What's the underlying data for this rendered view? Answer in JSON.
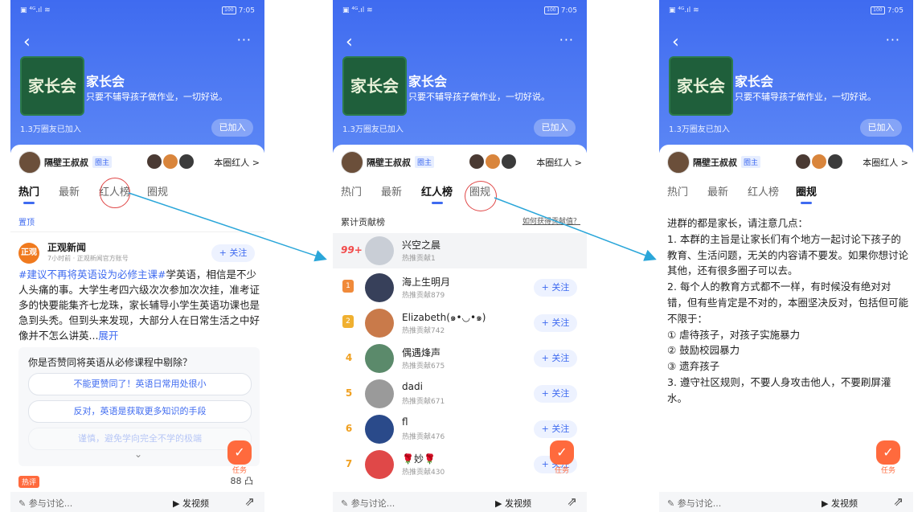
{
  "status": {
    "time": "7:05",
    "battery": "100"
  },
  "group": {
    "cover_text": "家长会",
    "title": "家长会",
    "desc": "只要不辅导孩子做作业，一切好说。",
    "members": "1.3万圈友已加入",
    "joined_label": "已加入",
    "owner": "隔壁王叔叔",
    "owner_badge": "圈主",
    "red_talent": "本圈红人 >"
  },
  "tabs": [
    "热门",
    "最新",
    "红人榜",
    "圈规"
  ],
  "screen1": {
    "pin": "置顶",
    "news_icon": "正观",
    "news_name": "正观新闻",
    "news_meta": "7小时前 · 正观新闻官方账号",
    "follow": "+ 关注",
    "post_tag": "#建议不再将英语设为必修主课#",
    "post_body": "学英语，相信是不少人头痛的事。大学生考四六级次次参加次次挂，准考证多的快要能集齐七龙珠，家长辅导小学生英语功课也是急到头秃。但到头来发现，大部分人在日常生活之中好像并不怎么讲英...",
    "expand": "展开",
    "poll_question": "你是否赞同将英语从必修课程中剔除？",
    "poll_options": [
      "不能更赞同了！英语日常用处很小",
      "反对，英语是获取更多知识的手段",
      "谨慎，避免学向完全不学的极端"
    ],
    "hot": "热评",
    "likes": "88 凸"
  },
  "screen2": {
    "rank_title": "累计贡献榜",
    "rank_link": "如何获得贡献值？",
    "me": {
      "rank": "99+",
      "name": "兴空之晨",
      "sub": "热推贡献1"
    },
    "rows": [
      {
        "rank": "1",
        "name": "海上生明月",
        "sub": "热推贡献879",
        "color": "#f08a3a"
      },
      {
        "rank": "2",
        "name": "Elizabeth(๑•◡•๑)",
        "sub": "热推贡献742",
        "color": "#f0b030"
      },
      {
        "rank": "4",
        "name": "偶遇烽声",
        "sub": "热推贡献675",
        "color": "#5b8a6b"
      },
      {
        "rank": "5",
        "name": "dadi",
        "sub": "热推贡献671",
        "color": "#9a9a9a"
      },
      {
        "rank": "6",
        "name": "fl",
        "sub": "热推贡献476",
        "color": "#2a4a8a"
      },
      {
        "rank": "7",
        "name": "🌹妙🌹",
        "sub": "热推贡献430",
        "color": "#e04848"
      }
    ],
    "follow": "+ 关注"
  },
  "screen3": {
    "rules": [
      "进群的都是家长，请注意几点：",
      "1. 本群的主旨是让家长们有个地方一起讨论下孩子的教育、生活问题，无关的内容请不要发。如果你想讨论其他，还有很多圈子可以去。",
      "2. 每个人的教育方式都不一样，有时候没有绝对对错，但有些肯定是不对的，本圈坚决反对，包括但可能不限于：",
      "① 虐待孩子，对孩子实施暴力",
      "② 鼓励校园暴力",
      "③ 遗弃孩子",
      "3. 遵守社区规则，不要人身攻击他人，不要刷屏灌水。"
    ]
  },
  "fab_label": "任务",
  "bottom": {
    "discuss": "参与讨论...",
    "video": "发视频"
  },
  "colors": {
    "accent": "#3f6bf0",
    "header": "#4a76f2",
    "highlight": "#e04848",
    "arrow": "#2aa6d9"
  }
}
